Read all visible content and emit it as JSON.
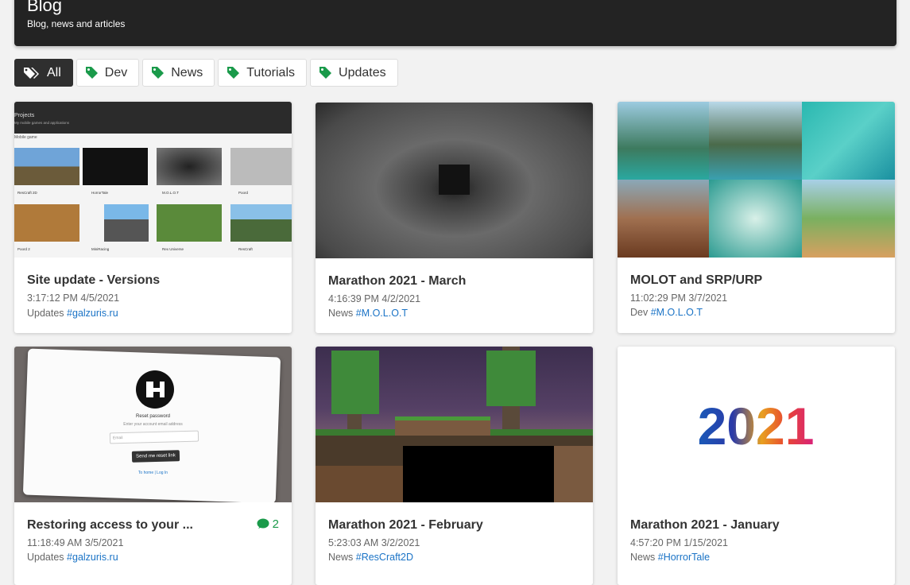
{
  "header": {
    "title": "Blog",
    "subtitle": "Blog, news and articles"
  },
  "filters": [
    {
      "label": "All",
      "active": true
    },
    {
      "label": "Dev",
      "active": false
    },
    {
      "label": "News",
      "active": false
    },
    {
      "label": "Tutorials",
      "active": false
    },
    {
      "label": "Updates",
      "active": false
    }
  ],
  "projects_thumb": {
    "title": "Projects",
    "subtitle": "My mobile games and applications",
    "section": "Mobile game",
    "tiles": [
      "ResCraft 2D",
      "HorrorTale",
      "M.O.L.O.T",
      "Poord",
      "Poord 2",
      "MiniRacing",
      "Rex Universe",
      "ResCraft"
    ]
  },
  "reset_thumb": {
    "heading": "Reset password",
    "hint": "Enter your account email address",
    "email_placeholder": "Email",
    "button": "Send me reset link",
    "links": "To home | Log In"
  },
  "year_logo": "2021",
  "posts": [
    {
      "title": "Site update - Versions",
      "time": "3:17:12 PM 4/5/2021",
      "category": "Updates",
      "tag": "#galzuris.ru"
    },
    {
      "title": "Marathon 2021 - March",
      "time": "4:16:39 PM 4/2/2021",
      "category": "News",
      "tag": "#M.O.L.O.T"
    },
    {
      "title": "MOLOT and SRP/URP",
      "time": "11:02:29 PM 3/7/2021",
      "category": "Dev",
      "tag": "#M.O.L.O.T"
    },
    {
      "title": "Restoring access to your ...",
      "time": "11:18:49 AM 3/5/2021",
      "category": "Updates",
      "tag": "#galzuris.ru",
      "comments": "2"
    },
    {
      "title": "Marathon 2021 - February",
      "time": "5:23:03 AM 3/2/2021",
      "category": "News",
      "tag": "#ResCraft2D"
    },
    {
      "title": "Marathon 2021 - January",
      "time": "4:57:20 PM 1/15/2021",
      "category": "News",
      "tag": "#HorrorTale"
    }
  ],
  "colors": {
    "header": "#232323",
    "tag_icon": "#1a9a4a",
    "link": "#1a73c6"
  }
}
